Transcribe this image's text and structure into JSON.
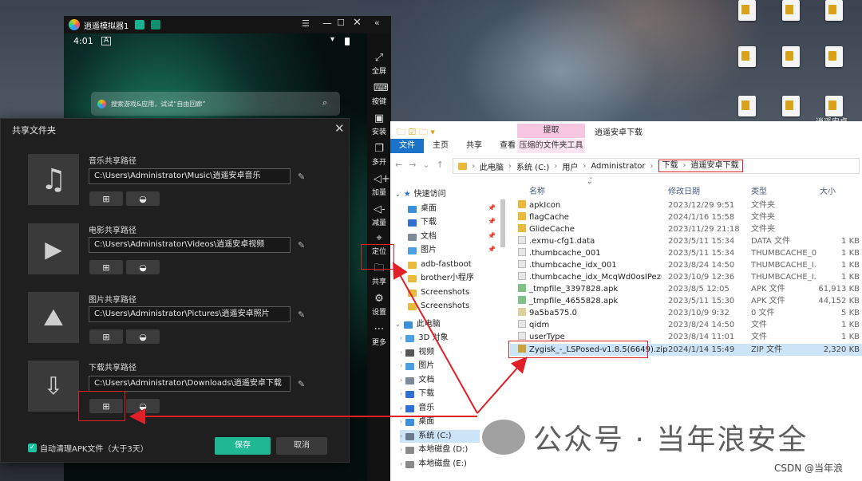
{
  "desktop": {
    "icon_label": "逍遥安卓"
  },
  "emulator": {
    "title": "逍遥模拟器1",
    "status": {
      "time": "4:01",
      "indicator": "A"
    },
    "search_placeholder": "搜索游戏&应用，试试“自由回廊”",
    "sidebar": [
      {
        "label": "全屏",
        "icon": "fullscreen-icon"
      },
      {
        "label": "按键",
        "icon": "keyboard-icon"
      },
      {
        "label": "安装",
        "icon": "apk-icon"
      },
      {
        "label": "多开",
        "icon": "multi-window-icon"
      },
      {
        "label": "加量",
        "icon": "volume-up-icon"
      },
      {
        "label": "减量",
        "icon": "volume-down-icon"
      },
      {
        "label": "定位",
        "icon": "location-icon"
      },
      {
        "label": "共享",
        "icon": "folder-icon"
      },
      {
        "label": "设置",
        "icon": "gear-icon"
      },
      {
        "label": "更多",
        "icon": "more-icon"
      }
    ]
  },
  "share_dialog": {
    "title": "共享文件夹",
    "sections": [
      {
        "label": "音乐共享路径",
        "path": "C:\\Users\\Administrator\\Music\\逍遥安卓音乐",
        "icon": "music-icon"
      },
      {
        "label": "电影共享路径",
        "path": "C:\\Users\\Administrator\\Videos\\逍遥安卓视频",
        "icon": "video-icon"
      },
      {
        "label": "图片共享路径",
        "path": "C:\\Users\\Administrator\\Pictures\\逍遥安卓照片",
        "icon": "image-icon"
      },
      {
        "label": "下载共享路径",
        "path": "C:\\Users\\Administrator\\Downloads\\逍遥安卓下载",
        "icon": "download-folder-icon"
      }
    ],
    "auto_clean_label": "自动清理APK文件（大于3天）",
    "save_label": "保存",
    "cancel_label": "取消"
  },
  "explorer": {
    "title": "逍遥安卓下载",
    "ribbon_tabs": [
      "文件",
      "主页",
      "共享",
      "查看"
    ],
    "ribbon_extract": "提取",
    "ribbon_extract_tools": "压缩的文件夹工具",
    "address": [
      "此电脑",
      "系统 (C:)",
      "用户",
      "Administrator",
      "下载",
      "逍遥安卓下载"
    ],
    "tree": [
      {
        "label": "快速访问",
        "pinned": false,
        "color": "#2f6fd1"
      },
      {
        "label": "桌面",
        "pinned": true,
        "color": "#3b8fd9"
      },
      {
        "label": "下载",
        "pinned": true,
        "color": "#2f6fd1"
      },
      {
        "label": "文档",
        "pinned": true,
        "color": "#7d8a99"
      },
      {
        "label": "图片",
        "pinned": true,
        "color": "#4aa0e0"
      },
      {
        "label": "adb-fastboot",
        "pinned": false,
        "color": "#e8b93c"
      },
      {
        "label": "brother小程序",
        "pinned": false,
        "color": "#e8b93c"
      },
      {
        "label": "Screenshots",
        "pinned": false,
        "color": "#e8b93c"
      },
      {
        "label": "Screenshots",
        "pinned": false,
        "color": "#e8b93c"
      },
      {
        "label": "此电脑",
        "pinned": false,
        "color": "#3b8fd9"
      },
      {
        "label": "3D 对象",
        "pinned": false,
        "color": "#4aa0e0"
      },
      {
        "label": "视频",
        "pinned": false,
        "color": "#555555"
      },
      {
        "label": "图片",
        "pinned": false,
        "color": "#4aa0e0"
      },
      {
        "label": "文档",
        "pinned": false,
        "color": "#7d8a99"
      },
      {
        "label": "下载",
        "pinned": false,
        "color": "#2f6fd1"
      },
      {
        "label": "音乐",
        "pinned": false,
        "color": "#2f6fd1"
      },
      {
        "label": "桌面",
        "pinned": false,
        "color": "#3b8fd9"
      },
      {
        "label": "系统 (C:)",
        "pinned": false,
        "color": "#6b7a8a"
      },
      {
        "label": "本地磁盘 (D:)",
        "pinned": false,
        "color": "#8a8a8a"
      },
      {
        "label": "本地磁盘 (E:)",
        "pinned": false,
        "color": "#8a8a8a"
      }
    ],
    "columns": {
      "name": "名称",
      "date": "修改日期",
      "type": "类型",
      "size": "大小"
    },
    "files": [
      {
        "name": "apkIcon",
        "date": "2023/12/29 9:51",
        "type": "文件夹",
        "size": "",
        "color": "#e8b93c"
      },
      {
        "name": "flagCache",
        "date": "2024/1/16 15:58",
        "type": "文件夹",
        "size": "",
        "color": "#e8b93c"
      },
      {
        "name": "GlideCache",
        "date": "2023/11/29 21:18",
        "type": "文件夹",
        "size": "",
        "color": "#e8b93c"
      },
      {
        "name": ".exmu-cfg1.data",
        "date": "2023/5/11 15:34",
        "type": "DATA 文件",
        "size": "1 KB",
        "color": "#cfcfcf"
      },
      {
        "name": ".thumbcache_001",
        "date": "2023/5/11 15:34",
        "type": "THUMBCACHE_0...",
        "size": "1 KB",
        "color": "#cfcfcf"
      },
      {
        "name": ".thumbcache_idx_001",
        "date": "2023/8/24 14:50",
        "type": "THUMBCACHE_I...",
        "size": "1 KB",
        "color": "#cfcfcf"
      },
      {
        "name": ".thumbcache_idx_McqWd0osIPezOD...",
        "date": "2023/10/9 12:36",
        "type": "THUMBCACHE_I...",
        "size": "1 KB",
        "color": "#cfcfcf"
      },
      {
        "name": "_tmpfile_3397828.apk",
        "date": "2023/8/5 12:05",
        "type": "APK 文件",
        "size": "61,913 KB",
        "color": "#7dc383"
      },
      {
        "name": "_tmpfile_4655828.apk",
        "date": "2023/5/11 15:30",
        "type": "APK 文件",
        "size": "44,152 KB",
        "color": "#7dc383"
      },
      {
        "name": "9a5ba575.0",
        "date": "2023/10/9 9:32",
        "type": "0 文件",
        "size": "5 KB",
        "color": "#d9d09a"
      },
      {
        "name": "qidm",
        "date": "2023/8/24 14:50",
        "type": "文件",
        "size": "1 KB",
        "color": "#cfcfcf"
      },
      {
        "name": "userType",
        "date": "2023/8/14 11:01",
        "type": "文件",
        "size": "1 KB",
        "color": "#cfcfcf"
      },
      {
        "name": "Zygisk_-_LSPosed-v1.8.5(6649).zip",
        "date": "2024/1/14 15:49",
        "type": "ZIP 文件",
        "size": "2,320 KB",
        "color": "#c9a33a"
      }
    ]
  },
  "watermark": {
    "main": "公众号 · 当年浪安全",
    "csdn": "CSDN @当年浪"
  }
}
